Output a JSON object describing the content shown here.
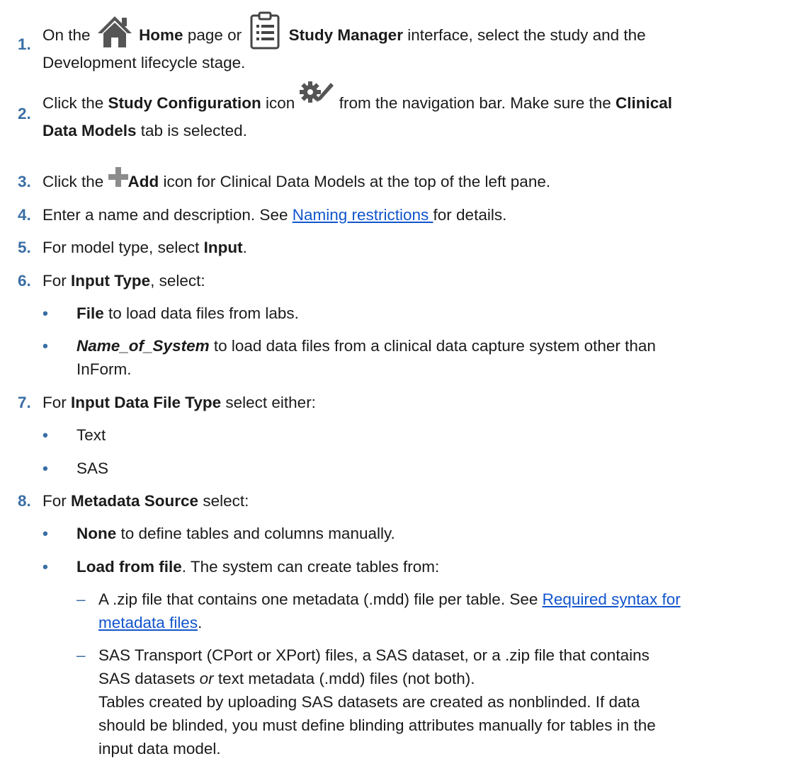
{
  "steps": [
    {
      "num": "1.",
      "t1": "On the ",
      "home_label": "Home",
      "t2": " page or ",
      "sm_label": "Study Manager",
      "t3": " interface, select the study and the",
      "line2": "Development lifecycle stage."
    },
    {
      "num": "2.",
      "t1": "Click the ",
      "sc_label": "Study Configuration",
      "t2": " icon ",
      "t3": " from the navigation bar. Make sure the ",
      "cdm1": "Clinical",
      "cdm2": "Data Models",
      "t4": " tab is selected."
    },
    {
      "num": "3.",
      "t1": "Click the ",
      "add_label": "Add",
      "t2": " icon for Clinical Data Models at the top of the left pane."
    },
    {
      "num": "4.",
      "t1": "Enter a name and description. See ",
      "link": "Naming restrictions ",
      "t2": "for details."
    },
    {
      "num": "5.",
      "t1": "For model type, select ",
      "b1": "Input",
      "t2": "."
    },
    {
      "num": "6.",
      "t1": "For ",
      "b1": "Input Type",
      "t2": ", select:"
    },
    {
      "num": "7.",
      "t1": "For ",
      "b1": "Input Data File Type",
      "t2": " select either:"
    },
    {
      "num": "8.",
      "t1": "For ",
      "b1": "Metadata Source",
      "t2": " select:"
    }
  ],
  "step6_bullets": [
    {
      "b": "File",
      "t": " to load data files from labs."
    },
    {
      "bi": "Name_of_System",
      "t": " to load data files from a clinical data capture system other than",
      "t2": "InForm."
    }
  ],
  "step7_bullets": [
    {
      "t": "Text"
    },
    {
      "t": "SAS"
    }
  ],
  "step8_bullets": [
    {
      "b": "None",
      "t": " to define tables and columns manually."
    },
    {
      "b": "Load from file",
      "t": ". The system can create tables from:"
    }
  ],
  "sub_items": [
    {
      "t1": "A .zip file that contains one metadata (.mdd) file per table. See ",
      "link1": "Required syntax for",
      "link2": "metadata files",
      "t2": "."
    },
    {
      "l1a": "SAS Transport (CPort or XPort) files, a SAS dataset, or a .zip file that contains",
      "l2a": "SAS datasets ",
      "l2or": "or",
      "l2b": " text metadata (.mdd) files (not both).",
      "l3": "Tables created by uploading SAS datasets are created as nonblinded. If data",
      "l4": "should be blinded, you must define blinding attributes manually for tables in the",
      "l5": "input data model."
    }
  ],
  "bullet_glyph": "•",
  "dash_glyph": "–",
  "icons": [
    "home-icon",
    "clipboard-list-icon",
    "gear-pencil-icon",
    "plus-icon"
  ],
  "colors": {
    "number": "#3a6ea5",
    "link": "#1155cc",
    "icon_dark": "#555555",
    "icon_gray": "#8c8c8c"
  }
}
